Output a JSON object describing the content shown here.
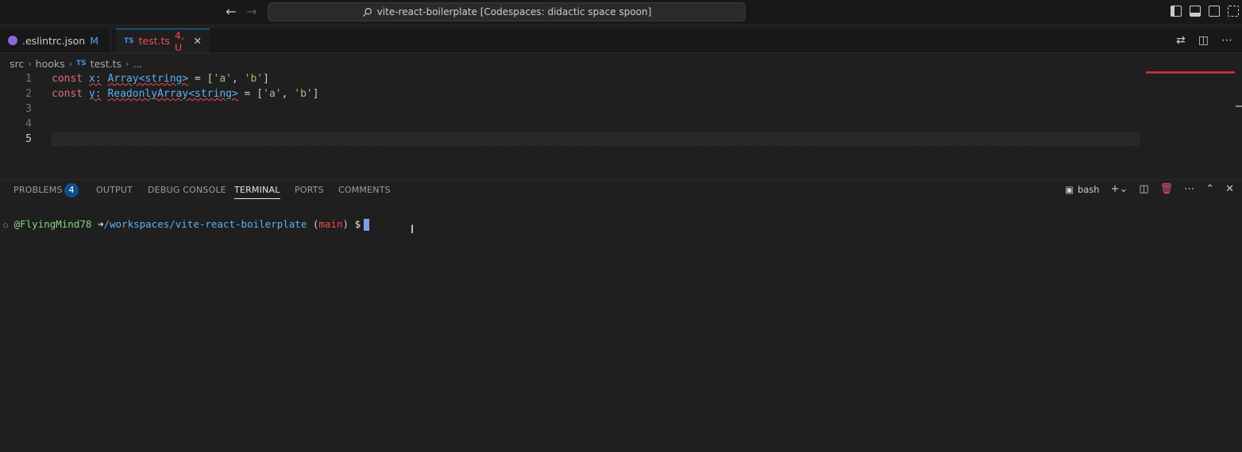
{
  "title": {
    "back_icon": "arrow-left-icon",
    "forward_icon": "arrow-right-icon",
    "search_text": "vite-react-boilerplate [Codespaces: didactic space spoon]"
  },
  "tabs": [
    {
      "label": ".eslintrc.json",
      "status": "M",
      "icon": "eslint-icon"
    },
    {
      "label": "test.ts",
      "status": "4, U",
      "icon_text": "TS"
    }
  ],
  "breadcrumb": [
    "src",
    "hooks",
    "test.ts",
    "..."
  ],
  "breadcrumb_icon_text": "TS",
  "editor": {
    "lines": [
      {
        "no": "1",
        "kw": "const",
        "id": "x:",
        "type": "Array<string>",
        "rest": " = [",
        "s1": "'a'",
        "comma": ", ",
        "s2": "'b'",
        "end": "]"
      },
      {
        "no": "2",
        "kw": "const",
        "id": "y:",
        "type": "ReadonlyArray<string>",
        "rest": " = [",
        "s1": "'a'",
        "comma": ", ",
        "s2": "'b'",
        "end": "]"
      },
      {
        "no": "3"
      },
      {
        "no": "4"
      },
      {
        "no": "5"
      }
    ]
  },
  "panel": {
    "tabs": [
      "PROBLEMS",
      "OUTPUT",
      "DEBUG CONSOLE",
      "TERMINAL",
      "PORTS",
      "COMMENTS"
    ],
    "problems_count": "4",
    "active_tab": "TERMINAL",
    "shell_label": "bash"
  },
  "terminal": {
    "circle": "○",
    "user": "@FlyingMind78",
    "arrow": "➜",
    "path": "/workspaces/vite-react-boilerplate",
    "branch_open": "(",
    "branch": "main",
    "branch_close": ")",
    "dollar": "$"
  },
  "colors": {
    "accent": "#0078d4",
    "error": "#f14c4c",
    "badge": "#0e4f8b"
  }
}
